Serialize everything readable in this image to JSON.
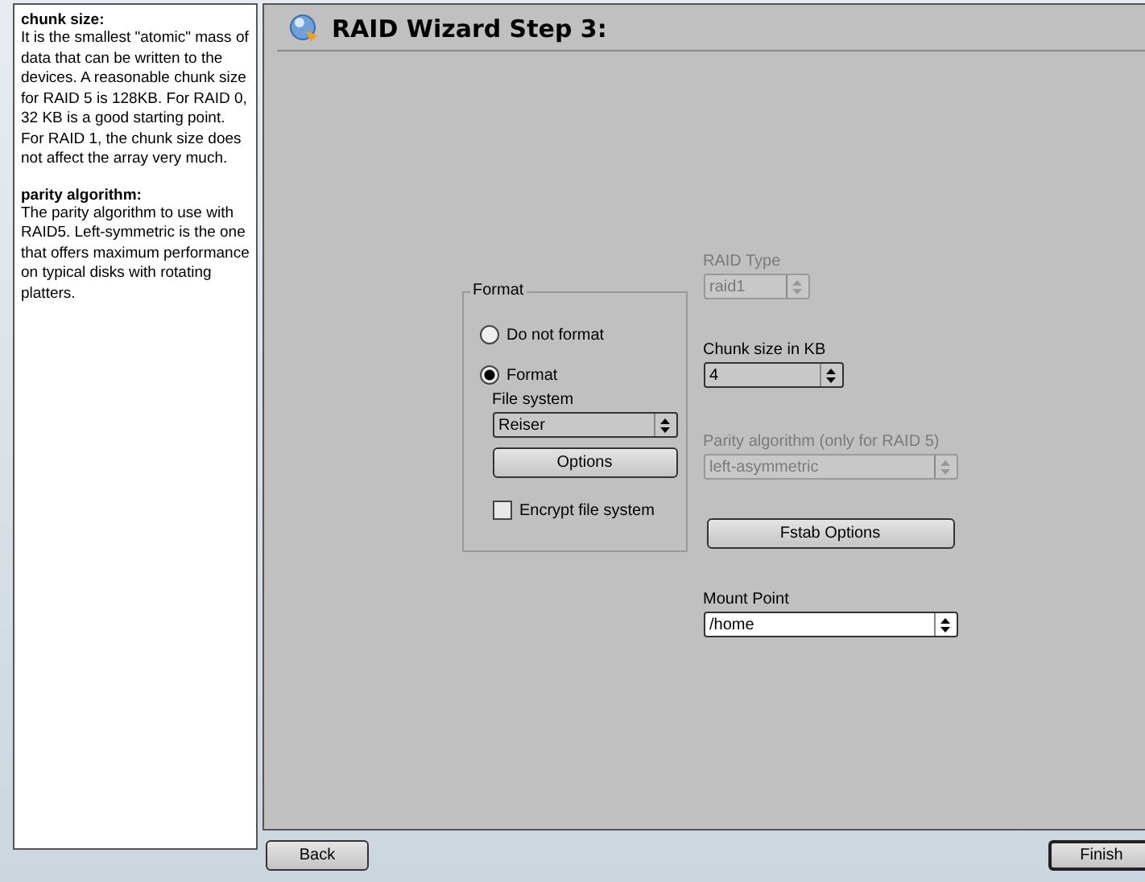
{
  "help": {
    "sections": [
      {
        "heading": "chunk size:",
        "text": "It is the smallest \"atomic\" mass of data that can be written to the devices. A reasonable chunk size for RAID 5 is 128KB. For RAID 0, 32 KB is a good starting point. For RAID 1, the chunk size does not affect the array very much."
      },
      {
        "heading": "parity algorithm:",
        "text": "The parity algorithm to use with RAID5. Left-symmetric is the one that offers maximum performance on typical disks with rotating platters."
      }
    ]
  },
  "title": "RAID Wizard Step 3:",
  "format_group": {
    "title": "Format",
    "options": [
      {
        "label": "Do not format",
        "selected": false
      },
      {
        "label": "Format",
        "selected": true
      }
    ],
    "file_system": {
      "label": "File system",
      "value": "Reiser"
    },
    "options_button": "Options",
    "encrypt": {
      "label": "Encrypt file system",
      "checked": false
    }
  },
  "raid_type": {
    "label": "RAID Type",
    "value": "raid1",
    "disabled": true
  },
  "chunk_size": {
    "label": "Chunk size in KB",
    "value": "4",
    "disabled": false
  },
  "parity": {
    "label": "Parity algorithm (only for RAID 5)",
    "value": "left-asymmetric",
    "disabled": true
  },
  "fstab_button": "Fstab Options",
  "mount_point": {
    "label": "Mount Point",
    "value": "/home"
  },
  "buttons": {
    "back": "Back",
    "finish": "Finish"
  }
}
